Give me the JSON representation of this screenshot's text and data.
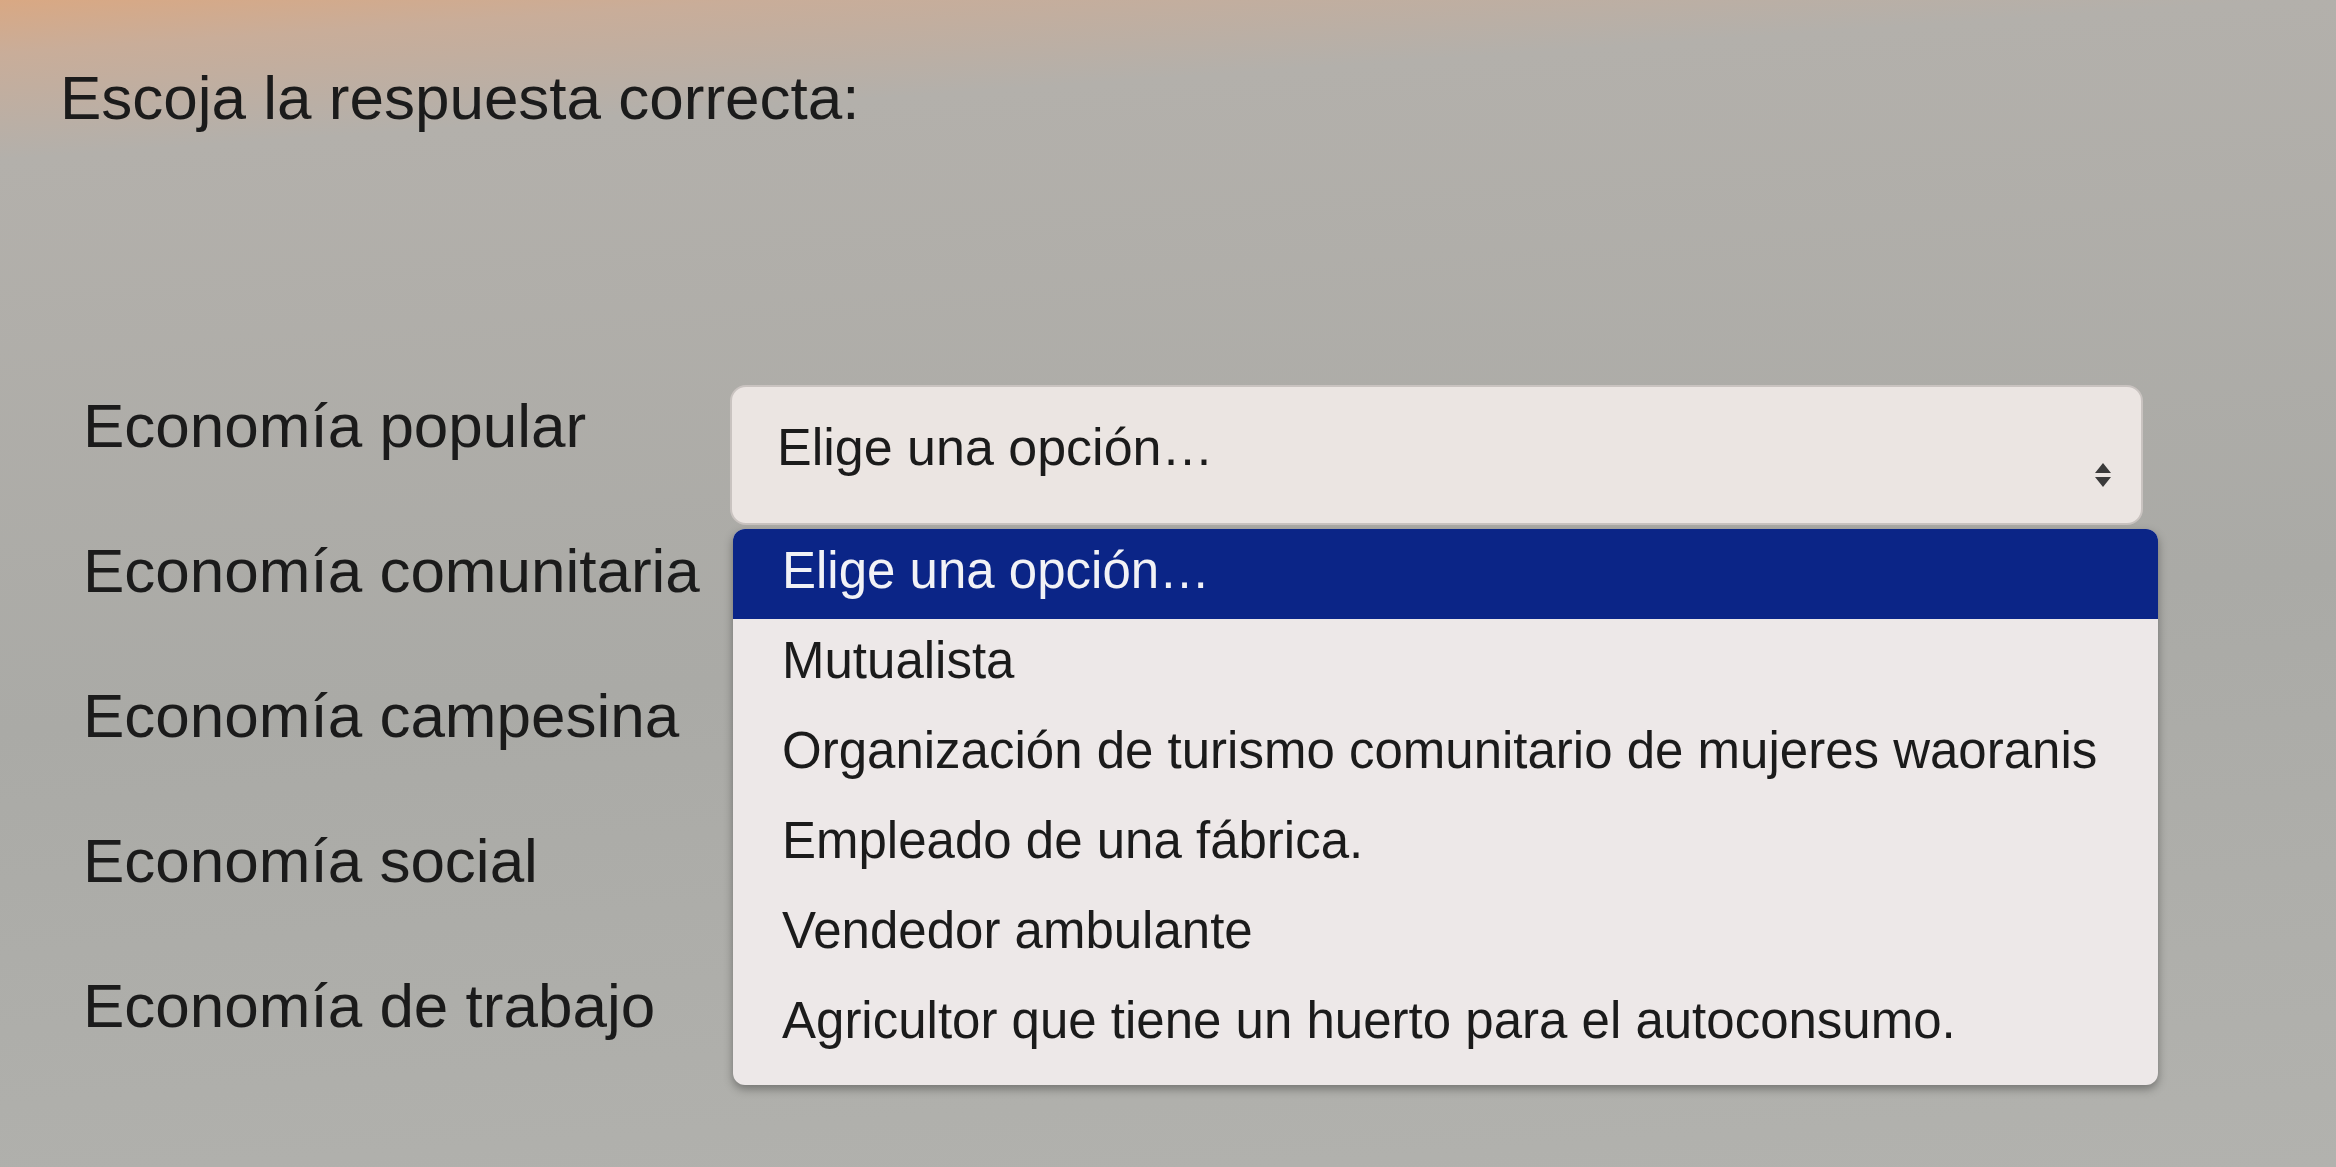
{
  "title": "Escoja la respuesta correcta:",
  "rows": [
    {
      "label": "Economía popular"
    },
    {
      "label": "Economía comunitaria"
    },
    {
      "label": "Economía campesina"
    },
    {
      "label": "Economía social"
    },
    {
      "label": "Economía de trabajo"
    }
  ],
  "dropdown": {
    "value": "Elige una opción…",
    "expanded": true,
    "options": [
      {
        "label": "Elige una opción…",
        "selected": true
      },
      {
        "label": "Mutualista",
        "selected": false
      },
      {
        "label": "Organización de turismo comunitario de mujeres waoranis",
        "selected": false
      },
      {
        "label": "Empleado de una fábrica.",
        "selected": false
      },
      {
        "label": "Vendedor ambulante",
        "selected": false
      },
      {
        "label": "Agricultor que tiene un huerto para el autoconsumo.",
        "selected": false
      }
    ]
  }
}
